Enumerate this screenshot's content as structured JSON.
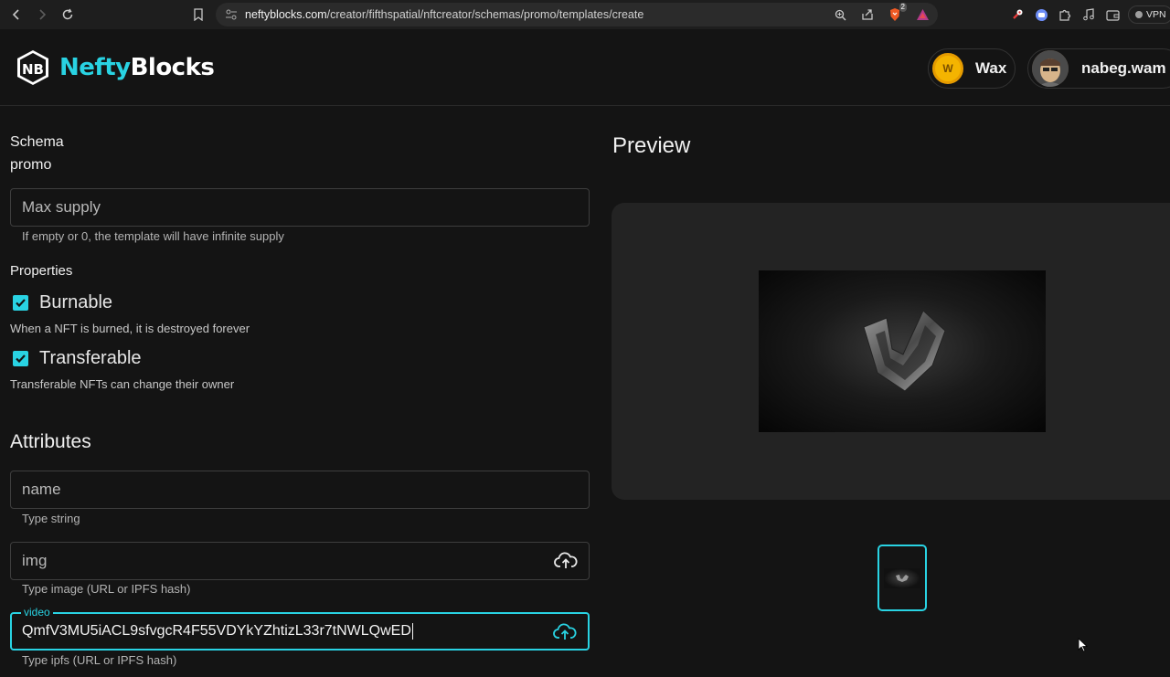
{
  "browser": {
    "url_host": "neftyblocks.com",
    "url_path": "/creator/fifthspatial/nftcreator/schemas/promo/templates/create",
    "brave_badge": "2",
    "vpn_label": "VPN"
  },
  "header": {
    "logo_nefty": "Nefty",
    "logo_blocks": "Blocks",
    "logo_mark": "NB",
    "wallet_label": "Wax",
    "wallet_coin": "W",
    "username": "nabeg.wam"
  },
  "form": {
    "schema_label": "Schema",
    "schema_value": "promo",
    "max_supply_placeholder": "Max supply",
    "max_supply_help": "If empty or 0, the template will have infinite supply",
    "properties_label": "Properties",
    "burnable_label": "Burnable",
    "burnable_help": "When a NFT is burned, it is destroyed forever",
    "transferable_label": "Transferable",
    "transferable_help": "Transferable NFTs can change their owner",
    "attributes_title": "Attributes",
    "attributes": [
      {
        "placeholder": "name",
        "help": "Type string"
      },
      {
        "placeholder": "img",
        "help": "Type image (URL or IPFS hash)"
      },
      {
        "legend": "video",
        "value": "QmfV3MU5iACL9sfvgcR4F55VDYkYZhtizL33r7tNWLQwED",
        "help": "Type ipfs (URL or IPFS hash)"
      }
    ]
  },
  "preview": {
    "title": "Preview"
  },
  "colors": {
    "accent": "#29d3e3",
    "background": "#141414",
    "card": "#232323"
  }
}
